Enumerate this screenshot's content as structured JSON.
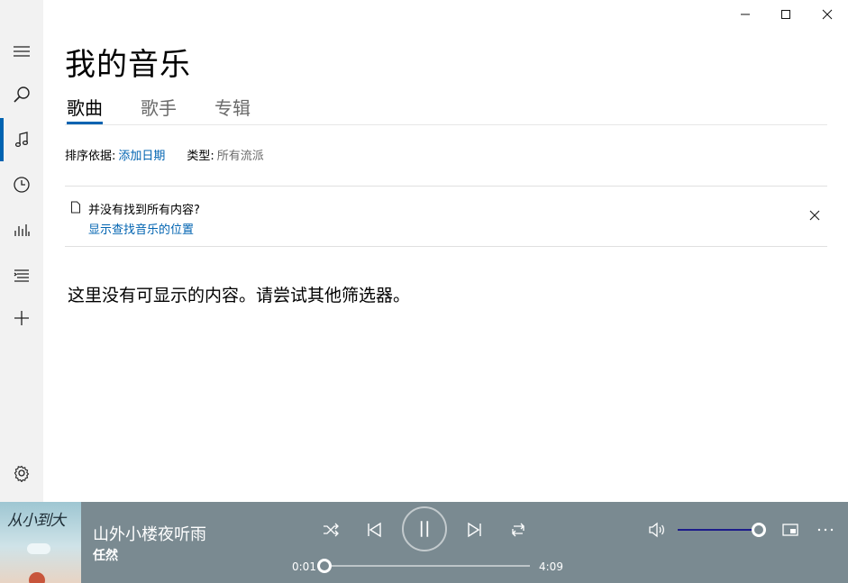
{
  "window": {
    "minimize_icon": "minimize-icon",
    "maximize_icon": "maximize-icon",
    "close_icon": "close-icon"
  },
  "sidebar": {
    "items": [
      {
        "icon": "hamburger-menu-icon"
      },
      {
        "icon": "search-icon"
      },
      {
        "icon": "music-note-icon",
        "active": true
      },
      {
        "icon": "clock-icon"
      },
      {
        "icon": "bar-chart-icon"
      },
      {
        "icon": "playlist-icon"
      },
      {
        "icon": "plus-icon"
      },
      {
        "icon": "gear-icon"
      }
    ]
  },
  "page": {
    "title": "我的音乐",
    "tabs": [
      {
        "label": "歌曲",
        "active": true
      },
      {
        "label": "歌手",
        "active": false
      },
      {
        "label": "专辑",
        "active": false
      }
    ]
  },
  "sort": {
    "sort_label": "排序依据:",
    "sort_value": "添加日期",
    "type_label": "类型:",
    "type_value": "所有流派"
  },
  "notice": {
    "title": "并没有找到所有内容?",
    "link": "显示查找音乐的位置"
  },
  "empty_message": "这里没有可显示的内容。请尝试其他筛选器。",
  "player": {
    "album_text": "从小到大",
    "track_title": "山外小楼夜听雨",
    "track_artist": "任然",
    "elapsed": "0:01",
    "duration": "4:09",
    "progress_fraction": 0.004,
    "volume_fraction": 1.0,
    "accent_color": "#1c1c8a",
    "bar_color": "#7a8a91"
  }
}
